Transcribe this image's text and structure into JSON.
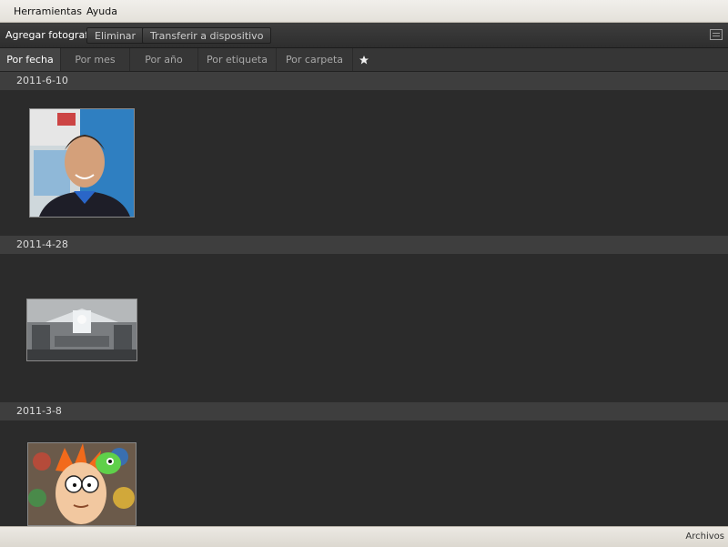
{
  "menubar": {
    "items": [
      "Herramientas",
      "Ayuda"
    ]
  },
  "toolbar": {
    "add_photos": "Agregar fotografías",
    "delete": "Eliminar",
    "transfer": "Transferir a dispositivo",
    "view_icon": "list-view-icon"
  },
  "tabs": {
    "items": [
      "Por fecha",
      "Por mes",
      "Por año",
      "Por etiqueta",
      "Por carpeta"
    ],
    "active": "Por fecha",
    "star_icon": "star-icon"
  },
  "groups": [
    {
      "date": "2011-6-10",
      "photo": "portrait photo of smiling man"
    },
    {
      "date": "2011-4-28",
      "photo": "black and white photo of a room"
    },
    {
      "date": "2011-3-8",
      "photo": "cartoon character with green creature"
    }
  ],
  "status": {
    "label": "Archivos"
  },
  "colors": {
    "background": "#2b2b2b",
    "header": "#3e3e3e",
    "menubar": "#e9e6df"
  }
}
